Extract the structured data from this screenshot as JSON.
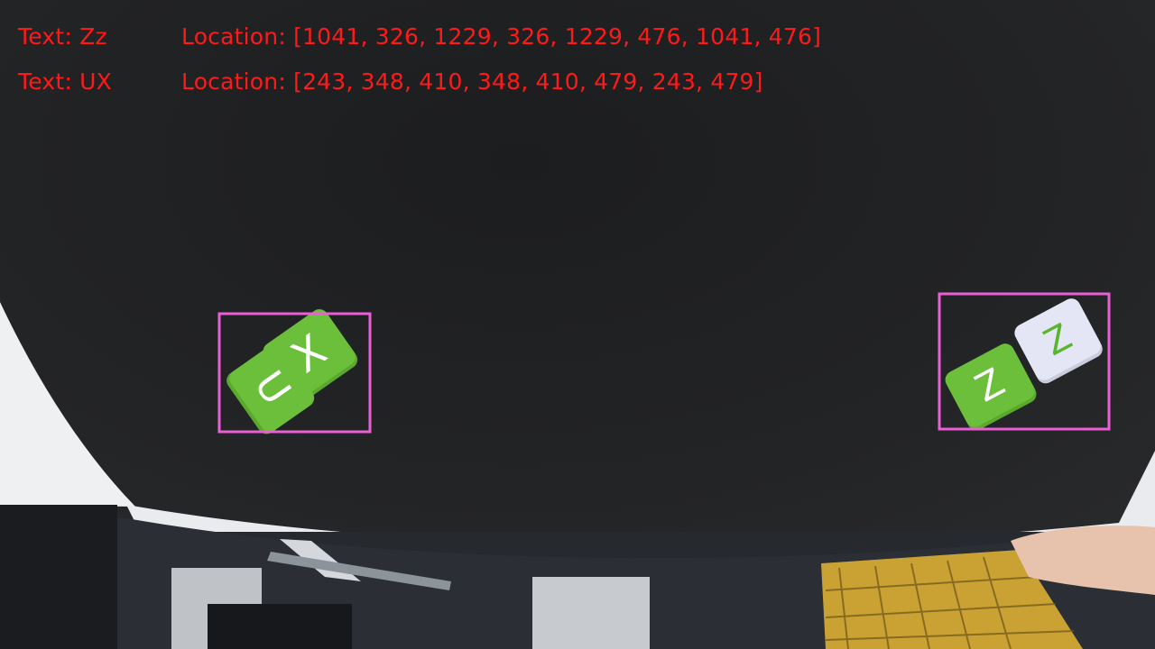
{
  "detections": [
    {
      "text": "Zz",
      "location": "[1041, 326, 1229, 326, 1229, 476, 1041, 476]"
    },
    {
      "text": "UX",
      "location": "[243, 348, 410, 348, 410, 479, 243, 479]"
    }
  ],
  "labels": {
    "text_prefix": "Text: ",
    "location_prefix": "Location: "
  },
  "colors": {
    "overlay_text": "#ff1a1a",
    "box_outline": "#ea5fd6",
    "tile_green": "#6cbf3a",
    "tile_white": "#e4e6f5"
  },
  "tiles": {
    "left": [
      "U",
      "X"
    ],
    "right": [
      "Z",
      "Z"
    ]
  }
}
